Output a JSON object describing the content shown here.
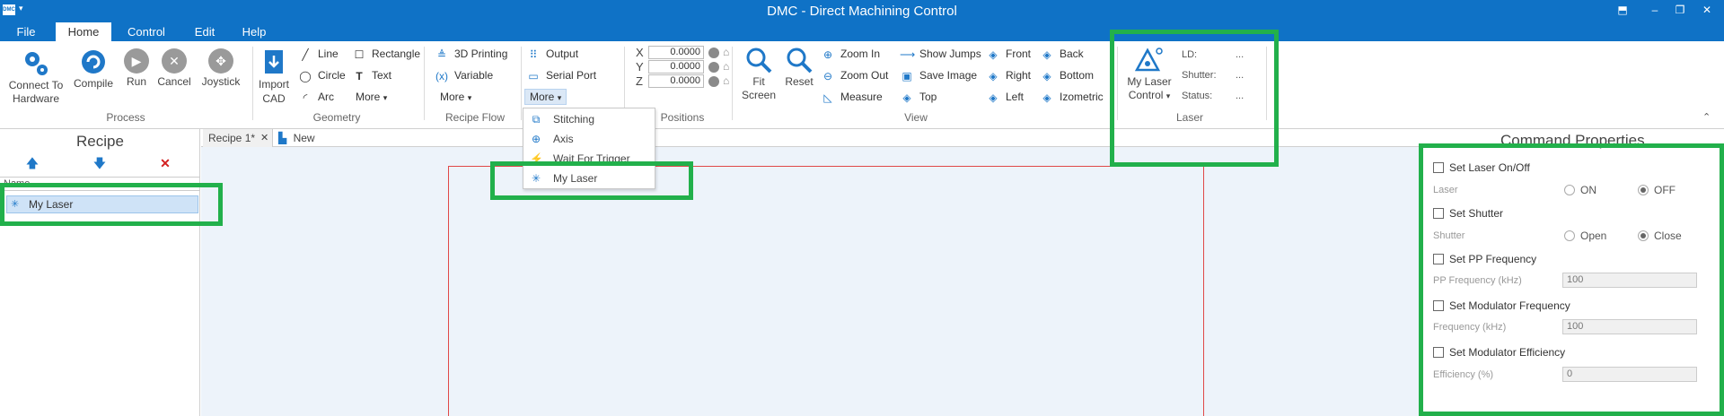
{
  "window": {
    "title": "DMC - Direct Machining Control",
    "app_icon": "DMC"
  },
  "menu_tabs": [
    "File",
    "Home",
    "Control",
    "Edit",
    "Help"
  ],
  "ribbon": {
    "process": {
      "label": "Process",
      "buttons": [
        "Connect To Hardware",
        "Compile",
        "Run",
        "Cancel",
        "Joystick"
      ]
    },
    "geometry": {
      "label": "Geometry",
      "import": "Import CAD",
      "items": [
        "Line",
        "Circle",
        "Arc",
        "Rectangle",
        "Text",
        "More"
      ]
    },
    "recipe_flow": {
      "label": "Recipe Flow",
      "items": [
        "3D Printing",
        "Variable",
        "More"
      ]
    },
    "io": {
      "items": [
        "Output",
        "Serial Port",
        "More"
      ]
    },
    "positions": {
      "label": "Positions",
      "rows": [
        {
          "axis": "X",
          "value": "0.0000"
        },
        {
          "axis": "Y",
          "value": "0.0000"
        },
        {
          "axis": "Z",
          "value": "0.0000"
        }
      ]
    },
    "view": {
      "label": "View",
      "fit_screen": "Fit Screen",
      "reset": "Reset",
      "items": [
        "Zoom In",
        "Zoom Out",
        "Measure",
        "Show Jumps",
        "Save Image",
        "Top",
        "Front",
        "Right",
        "Left",
        "Back",
        "Bottom",
        "Izometric"
      ]
    },
    "laser": {
      "label": "Laser",
      "button": "My Laser Control",
      "info": [
        {
          "label": "LD:",
          "value": "..."
        },
        {
          "label": "Shutter:",
          "value": "..."
        },
        {
          "label": "Status:",
          "value": "..."
        }
      ]
    }
  },
  "dropdown_more": [
    "Stitching",
    "Axis",
    "Wait For Trigger",
    "My Laser"
  ],
  "recipe_panel": {
    "title": "Recipe",
    "header": "Name",
    "items": [
      "My Laser"
    ]
  },
  "doc_tabs": [
    "Recipe 1*",
    "New"
  ],
  "command_properties": {
    "title": "Command Properties",
    "set_laser": "Set Laser On/Off",
    "laser_label": "Laser",
    "laser_on": "ON",
    "laser_off": "OFF",
    "set_shutter": "Set Shutter",
    "shutter_label": "Shutter",
    "shutter_open": "Open",
    "shutter_close": "Close",
    "set_pp": "Set PP Frequency",
    "pp_label": "PP Frequency (kHz)",
    "pp_value": "100",
    "set_mod_freq": "Set Modulator Frequency",
    "freq_label": "Frequency (kHz)",
    "freq_value": "100",
    "set_mod_eff": "Set Modulator Efficiency",
    "eff_label": "Efficiency (%)",
    "eff_value": "0"
  },
  "colors": {
    "accent": "#0f72c6",
    "highlight": "#22b04b",
    "canvas": "#edf3fa",
    "workarea_border": "#e04848"
  }
}
